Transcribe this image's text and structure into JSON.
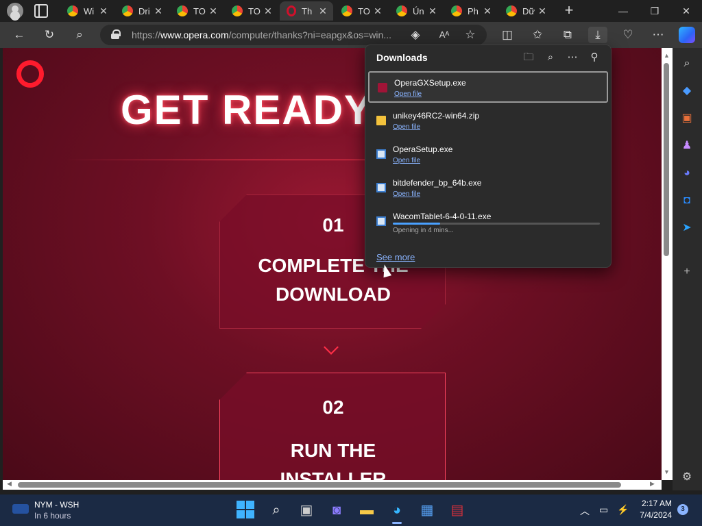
{
  "tabs": [
    {
      "title": "Wi",
      "favicon": "chrome-icon"
    },
    {
      "title": "Dri",
      "favicon": "chrome-icon"
    },
    {
      "title": "TO",
      "favicon": "chrome-icon"
    },
    {
      "title": "TO",
      "favicon": "chrome-icon"
    },
    {
      "title": "Th",
      "favicon": "opera-icon",
      "active": true
    },
    {
      "title": "TO",
      "favicon": "chrome-icon"
    },
    {
      "title": "Ún",
      "favicon": "chrome-icon"
    },
    {
      "title": "Ph",
      "favicon": "chrome-icon"
    },
    {
      "title": "Dữ",
      "favicon": "chrome-icon"
    }
  ],
  "address_bar": {
    "prefix": "https://",
    "domain": "www.opera.com",
    "path": "/computer/thanks?ni=eapgx&os=win..."
  },
  "page": {
    "headline": "GET READY",
    "step1_number": "01",
    "step1_text": "COMPLETE THE\nDOWNLOAD",
    "step2_number": "02",
    "step2_text": "RUN THE\nINSTALLER"
  },
  "downloads": {
    "title": "Downloads",
    "items": [
      {
        "name": "OperaGXSetup.exe",
        "action": "Open file",
        "icon": "opera-gx-icon"
      },
      {
        "name": "unikey46RC2-win64.zip",
        "action": "Open file",
        "icon": "zip-folder-icon"
      },
      {
        "name": "OperaSetup.exe",
        "action": "Open file",
        "icon": "exe-icon"
      },
      {
        "name": "bitdefender_bp_64b.exe",
        "action": "Open file",
        "icon": "exe-icon"
      },
      {
        "name": "WacomTablet-6-4-0-11.exe",
        "status": "Opening in 4 mins...",
        "progress": 0.23,
        "icon": "exe-icon"
      }
    ],
    "see_more": "See more"
  },
  "taskbar": {
    "weather_line1": "NYM - WSH",
    "weather_line2": "In 6 hours",
    "time": "2:17 AM",
    "date": "7/4/2024",
    "notifications": "3"
  },
  "colors": {
    "accent": "#ff1b2d",
    "page_bg": "#6e0f24",
    "link": "#8ab4ff"
  }
}
